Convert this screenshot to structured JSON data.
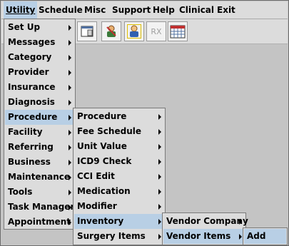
{
  "menubar": [
    {
      "label": "Utility",
      "active": true
    },
    {
      "label": "Schedule"
    },
    {
      "label": "Misc"
    },
    {
      "label": "Support"
    },
    {
      "label": "Help"
    },
    {
      "label": "Clinical"
    },
    {
      "label": "Exit"
    }
  ],
  "toolbar": {
    "rx_label": "RX"
  },
  "menu_utility": [
    "Set Up",
    "Messages",
    "Category",
    "Provider",
    "Insurance",
    "Diagnosis",
    "Procedure",
    "Facility",
    "Referring",
    "Business",
    "Maintenance",
    "Tools",
    "Task Manager",
    "Appointment"
  ],
  "menu_procedure": [
    "Procedure",
    "Fee Schedule",
    "Unit Value",
    "ICD9 Check",
    "CCI Edit",
    "Medication",
    "Modifier",
    "Inventory",
    "Surgery Items"
  ],
  "menu_inventory": [
    "Vendor Company",
    "Vendor Items"
  ],
  "menu_vendor_items": [
    "Add"
  ],
  "colors": {
    "highlight": "#b8cfe5",
    "menu_bg": "#dcdcdc"
  }
}
